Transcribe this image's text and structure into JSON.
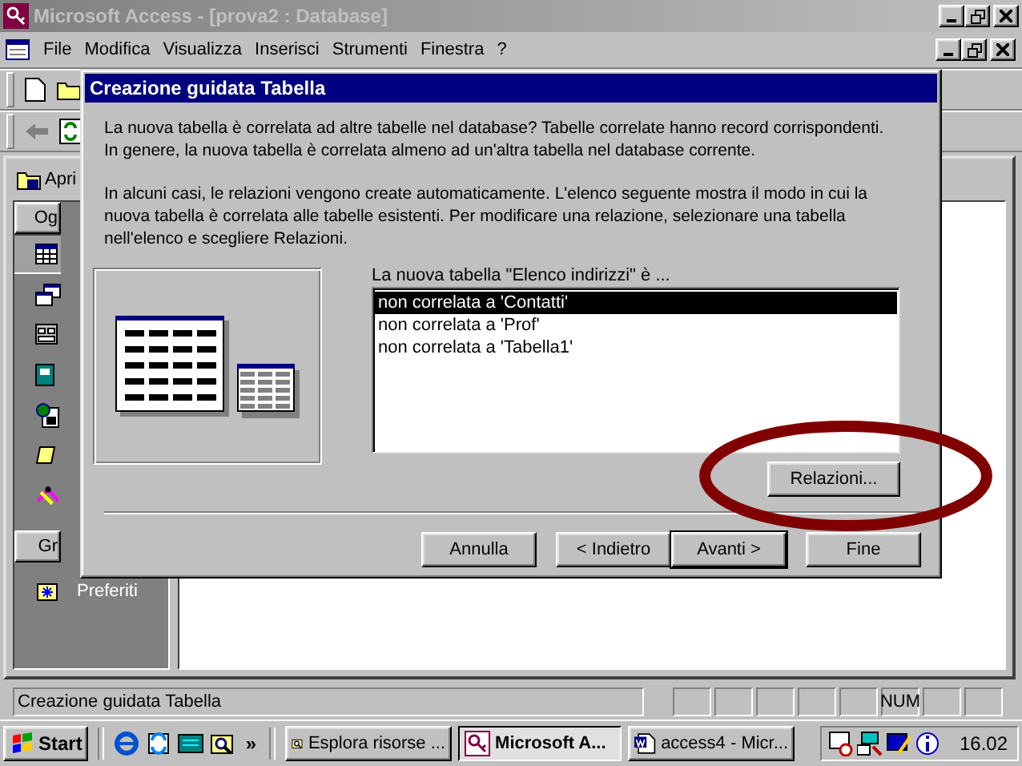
{
  "window": {
    "title": "Microsoft Access - [prova2 : Database]",
    "active": false
  },
  "menu": [
    "File",
    "Modifica",
    "Visualizza",
    "Inserisci",
    "Strumenti",
    "Finestra",
    "?"
  ],
  "database_window": {
    "open_button": "Apri",
    "groups": [
      "Og",
      "Gr"
    ],
    "object_types": [
      {
        "kind": "table",
        "selected": true
      },
      {
        "kind": "query",
        "selected": false
      },
      {
        "kind": "form",
        "selected": false
      },
      {
        "kind": "report",
        "selected": false
      },
      {
        "kind": "page",
        "selected": false
      },
      {
        "kind": "macro",
        "selected": false
      },
      {
        "kind": "module",
        "selected": false
      }
    ],
    "favorites": "Preferiti"
  },
  "dialog": {
    "title": "Creazione guidata Tabella",
    "paragraphs": [
      [
        "La nuova tabella è correlata ad altre tabelle nel database? Tabelle correlate hanno record corrispondenti.",
        "In genere, la nuova tabella è correlata almeno ad un'altra tabella nel database corrente."
      ],
      [
        "In alcuni casi, le relazioni vengono create automaticamente. L'elenco seguente mostra il modo in cui la",
        "nuova tabella è correlata alle tabelle esistenti. Per modificare una relazione, selezionare una tabella",
        "nell'elenco e scegliere Relazioni."
      ]
    ],
    "list_label": "La nuova tabella \"Elenco indirizzi\" è ...",
    "list_items": [
      {
        "label": "non correlata a 'Contatti'",
        "selected": true
      },
      {
        "label": "non correlata a 'Prof'",
        "selected": false
      },
      {
        "label": "non correlata a 'Tabella1'",
        "selected": false
      }
    ],
    "relations_button": "Relazioni...",
    "annotation": {
      "kind": "ellipse"
    },
    "buttons": [
      {
        "label": "Annulla",
        "default": false
      },
      {
        "label": "< Indietro",
        "default": false
      },
      {
        "label": "Avanti >",
        "default": true
      },
      {
        "label": "Fine",
        "default": false
      }
    ]
  },
  "status_bar": {
    "message": "Creazione guidata Tabella",
    "indicators": [
      {
        "kind": "blank"
      },
      {
        "kind": "blank"
      },
      {
        "kind": "blank"
      },
      {
        "kind": "blank"
      },
      {
        "kind": "blank"
      },
      {
        "kind": "text",
        "text": "NUM"
      },
      {
        "kind": "blank"
      },
      {
        "kind": "blank"
      }
    ]
  },
  "taskbar": {
    "start": "Start",
    "overflow": "»",
    "tasks": [
      {
        "kind": "explorer",
        "label": "Esplora risorse ...",
        "selected": false
      },
      {
        "kind": "access",
        "label": "Microsoft A...",
        "selected": true
      },
      {
        "kind": "word",
        "label": "access4 - Micr...",
        "selected": false
      }
    ],
    "clock": "16.02"
  }
}
